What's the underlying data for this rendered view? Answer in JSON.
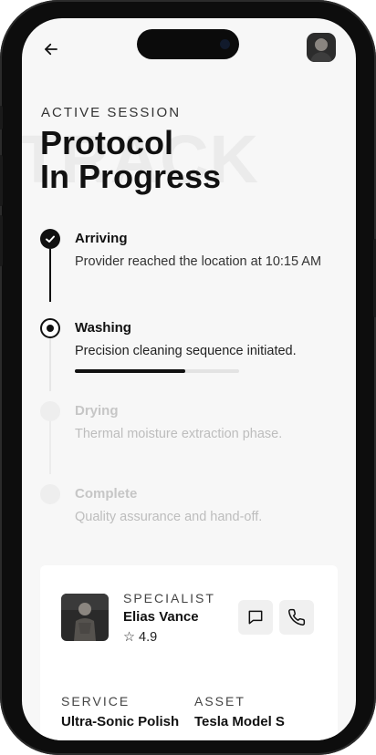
{
  "header": {
    "eyebrow": "ACTIVE SESSION",
    "title_line1": "Protocol",
    "title_line2": "In Progress",
    "watermark": "TRACK"
  },
  "steps": [
    {
      "title": "Arriving",
      "description": "Provider reached the location at 10:15 AM",
      "state": "done"
    },
    {
      "title": "Washing",
      "description": "Precision cleaning sequence initiated.",
      "state": "active",
      "progress": 0.67
    },
    {
      "title": "Drying",
      "description": "Thermal moisture extraction phase.",
      "state": "pending"
    },
    {
      "title": "Complete",
      "description": "Quality assurance and hand-off.",
      "state": "pending"
    }
  ],
  "specialist": {
    "label": "SPECIALIST",
    "name": "Elias Vance",
    "rating_text": "☆ 4.9"
  },
  "details": {
    "service_label": "SERVICE",
    "service_value": "Ultra-Sonic Polish",
    "asset_label": "ASSET",
    "asset_value": "Tesla Model S"
  },
  "icons": {
    "back": "arrow-left-icon",
    "message": "message-square-icon",
    "phone": "phone-icon",
    "check": "check-icon"
  },
  "colors": {
    "active": "#111111",
    "pending": "#cfcfcf",
    "progress_track": "#e3e3e3"
  }
}
